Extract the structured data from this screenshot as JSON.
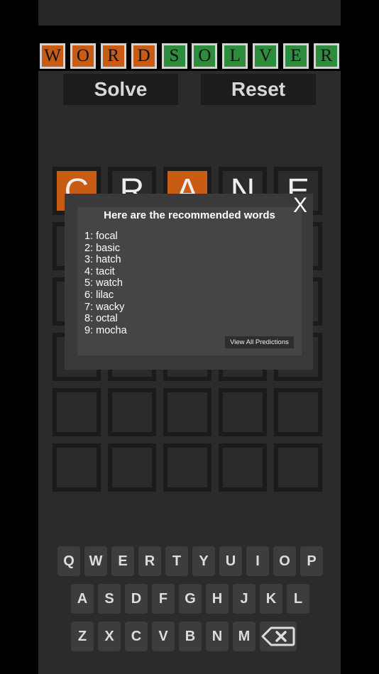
{
  "title_letters": [
    {
      "ch": "W",
      "color": "orange"
    },
    {
      "ch": "O",
      "color": "orange"
    },
    {
      "ch": "R",
      "color": "orange"
    },
    {
      "ch": "D",
      "color": "orange"
    },
    {
      "ch": "S",
      "color": "green"
    },
    {
      "ch": "O",
      "color": "green"
    },
    {
      "ch": "L",
      "color": "green"
    },
    {
      "ch": "V",
      "color": "green"
    },
    {
      "ch": "E",
      "color": "green"
    },
    {
      "ch": "R",
      "color": "green"
    }
  ],
  "buttons": {
    "solve": "Solve",
    "reset": "Reset"
  },
  "grid": {
    "rows": [
      [
        {
          "ch": "C",
          "state": "orange"
        },
        {
          "ch": "R",
          "state": "empty"
        },
        {
          "ch": "A",
          "state": "orange"
        },
        {
          "ch": "N",
          "state": "empty"
        },
        {
          "ch": "E",
          "state": "empty"
        }
      ],
      [
        {
          "ch": "",
          "state": "empty"
        },
        {
          "ch": "",
          "state": "empty"
        },
        {
          "ch": "",
          "state": "empty"
        },
        {
          "ch": "",
          "state": "empty"
        },
        {
          "ch": "",
          "state": "empty"
        }
      ],
      [
        {
          "ch": "",
          "state": "empty"
        },
        {
          "ch": "",
          "state": "empty"
        },
        {
          "ch": "",
          "state": "empty"
        },
        {
          "ch": "",
          "state": "empty"
        },
        {
          "ch": "",
          "state": "empty"
        }
      ],
      [
        {
          "ch": "",
          "state": "empty"
        },
        {
          "ch": "",
          "state": "empty"
        },
        {
          "ch": "",
          "state": "empty"
        },
        {
          "ch": "",
          "state": "empty"
        },
        {
          "ch": "",
          "state": "empty"
        }
      ],
      [
        {
          "ch": "",
          "state": "empty"
        },
        {
          "ch": "",
          "state": "empty"
        },
        {
          "ch": "",
          "state": "empty"
        },
        {
          "ch": "",
          "state": "empty"
        },
        {
          "ch": "",
          "state": "empty"
        }
      ],
      [
        {
          "ch": "",
          "state": "empty"
        },
        {
          "ch": "",
          "state": "empty"
        },
        {
          "ch": "",
          "state": "empty"
        },
        {
          "ch": "",
          "state": "empty"
        },
        {
          "ch": "",
          "state": "empty"
        }
      ]
    ]
  },
  "modal": {
    "close": "X",
    "title": "Here are the recommended words",
    "items": [
      "1: focal",
      "2: basic",
      "3: hatch",
      "4: tacit",
      "5: watch",
      "6: lilac",
      "7: wacky",
      "8: octal",
      "9: mocha"
    ],
    "view_all": "View All Predictions"
  },
  "keyboard": {
    "row1": [
      "Q",
      "W",
      "E",
      "R",
      "T",
      "Y",
      "U",
      "I",
      "O",
      "P"
    ],
    "row2": [
      "A",
      "S",
      "D",
      "F",
      "G",
      "H",
      "J",
      "K",
      "L"
    ],
    "row3": [
      "Z",
      "X",
      "C",
      "V",
      "B",
      "N",
      "M"
    ],
    "backspace_icon": "backspace-icon"
  },
  "colors": {
    "orange": "#c95c15",
    "green": "#2d8c3d",
    "background": "#2b2b2b"
  }
}
